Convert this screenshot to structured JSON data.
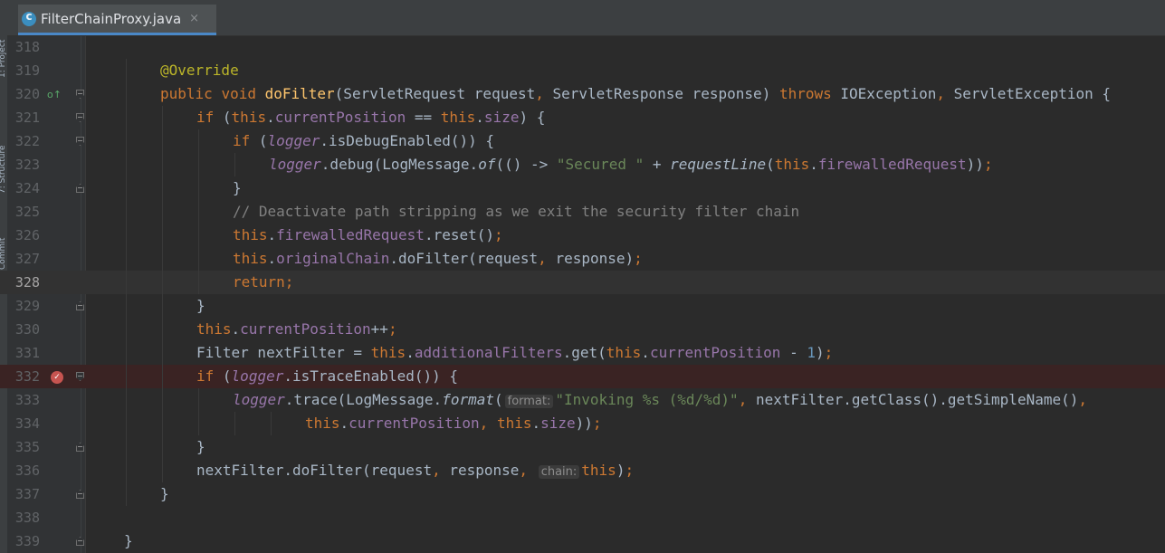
{
  "tab": {
    "title": "FilterChainProxy.java",
    "close_glyph": "×",
    "icon": "class-icon",
    "accent": "#4a88c7"
  },
  "side_panels": [
    "1: Project",
    "7: Structure",
    "Commit"
  ],
  "colors": {
    "background": "#2b2b2b",
    "keyword": "#cc7832",
    "field": "#9876aa",
    "method_decl": "#ffc66d",
    "string": "#6a8759",
    "number": "#6897bb",
    "comment": "#808080",
    "annotation": "#bbb529",
    "breakpoint": "#c75450"
  },
  "lines": [
    {
      "n": "318",
      "indent": 0,
      "tokens": []
    },
    {
      "n": "319",
      "indent": 2,
      "tokens": [
        [
          "ann",
          "@Override"
        ]
      ]
    },
    {
      "n": "320",
      "indent": 2,
      "gutter": "override-icon",
      "fold": "down",
      "tokens": [
        [
          "kw",
          "public "
        ],
        [
          "kw",
          "void "
        ],
        [
          "fn",
          "doFilter"
        ],
        [
          "pln",
          "(ServletRequest request"
        ],
        [
          "kw",
          ", "
        ],
        [
          "pln",
          "ServletResponse response) "
        ],
        [
          "kw",
          "throws "
        ],
        [
          "pln",
          "IOException"
        ],
        [
          "kw",
          ", "
        ],
        [
          "pln",
          "ServletException {"
        ]
      ]
    },
    {
      "n": "321",
      "indent": 3,
      "fold": "down",
      "tokens": [
        [
          "kw",
          "if "
        ],
        [
          "pln",
          "("
        ],
        [
          "kw",
          "this"
        ],
        [
          "pln",
          "."
        ],
        [
          "fld",
          "currentPosition"
        ],
        [
          "pln",
          " == "
        ],
        [
          "kw",
          "this"
        ],
        [
          "pln",
          "."
        ],
        [
          "fld",
          "size"
        ],
        [
          "pln",
          ") {"
        ]
      ]
    },
    {
      "n": "322",
      "indent": 4,
      "fold": "down",
      "tokens": [
        [
          "kw",
          "if "
        ],
        [
          "pln",
          "("
        ],
        [
          "sfld",
          "logger"
        ],
        [
          "pln",
          ".isDebugEnabled()) {"
        ]
      ]
    },
    {
      "n": "323",
      "indent": 5,
      "tokens": [
        [
          "sfld",
          "logger"
        ],
        [
          "pln",
          ".debug(LogMessage."
        ],
        [
          "sm",
          "of"
        ],
        [
          "pln",
          "(() -> "
        ],
        [
          "str",
          "\"Secured \""
        ],
        [
          "pln",
          " + "
        ],
        [
          "sm",
          "requestLine"
        ],
        [
          "pln",
          "("
        ],
        [
          "kw",
          "this"
        ],
        [
          "pln",
          "."
        ],
        [
          "fld",
          "firewalledRequest"
        ],
        [
          "pln",
          "))"
        ],
        [
          "kw",
          ";"
        ]
      ]
    },
    {
      "n": "324",
      "indent": 4,
      "fold": "up",
      "tokens": [
        [
          "pln",
          "}"
        ]
      ]
    },
    {
      "n": "325",
      "indent": 4,
      "tokens": [
        [
          "cmt",
          "// Deactivate path stripping as we exit the security filter chain"
        ]
      ]
    },
    {
      "n": "326",
      "indent": 4,
      "tokens": [
        [
          "kw",
          "this"
        ],
        [
          "pln",
          "."
        ],
        [
          "fld",
          "firewalledRequest"
        ],
        [
          "pln",
          ".reset()"
        ],
        [
          "kw",
          ";"
        ]
      ]
    },
    {
      "n": "327",
      "indent": 4,
      "tokens": [
        [
          "kw",
          "this"
        ],
        [
          "pln",
          "."
        ],
        [
          "fld",
          "originalChain"
        ],
        [
          "pln",
          ".doFilter(request"
        ],
        [
          "kw",
          ", "
        ],
        [
          "pln",
          "response)"
        ],
        [
          "kw",
          ";"
        ]
      ]
    },
    {
      "n": "328",
      "indent": 4,
      "current": true,
      "tokens": [
        [
          "kw",
          "return;"
        ]
      ]
    },
    {
      "n": "329",
      "indent": 3,
      "fold": "up",
      "tokens": [
        [
          "pln",
          "}"
        ]
      ]
    },
    {
      "n": "330",
      "indent": 3,
      "tokens": [
        [
          "kw",
          "this"
        ],
        [
          "pln",
          "."
        ],
        [
          "fld",
          "currentPosition"
        ],
        [
          "pln",
          "++"
        ],
        [
          "kw",
          ";"
        ]
      ]
    },
    {
      "n": "331",
      "indent": 3,
      "tokens": [
        [
          "pln",
          "Filter nextFilter = "
        ],
        [
          "kw",
          "this"
        ],
        [
          "pln",
          "."
        ],
        [
          "fld",
          "additionalFilters"
        ],
        [
          "pln",
          ".get("
        ],
        [
          "kw",
          "this"
        ],
        [
          "pln",
          "."
        ],
        [
          "fld",
          "currentPosition"
        ],
        [
          "pln",
          " - "
        ],
        [
          "num",
          "1"
        ],
        [
          "pln",
          ")"
        ],
        [
          "kw",
          ";"
        ]
      ]
    },
    {
      "n": "332",
      "indent": 3,
      "breakpoint": true,
      "gutter": "breakpoint-icon",
      "fold": "down",
      "tokens": [
        [
          "kw",
          "if "
        ],
        [
          "pln",
          "("
        ],
        [
          "sfld",
          "logger"
        ],
        [
          "pln",
          ".isTraceEnabled()) {"
        ]
      ]
    },
    {
      "n": "333",
      "indent": 4,
      "tokens": [
        [
          "sfld",
          "logger"
        ],
        [
          "pln",
          ".trace(LogMessage."
        ],
        [
          "sm",
          "format"
        ],
        [
          "pln",
          "("
        ],
        [
          "hint",
          "format:"
        ],
        [
          "str",
          "\"Invoking %s (%d/%d)\""
        ],
        [
          "kw",
          ", "
        ],
        [
          "pln",
          "nextFilter.getClass().getSimpleName()"
        ],
        [
          "kw",
          ","
        ]
      ]
    },
    {
      "n": "334",
      "indent": 6,
      "tokens": [
        [
          "kw",
          "this"
        ],
        [
          "pln",
          "."
        ],
        [
          "fld",
          "currentPosition"
        ],
        [
          "kw",
          ", "
        ],
        [
          "kw",
          "this"
        ],
        [
          "pln",
          "."
        ],
        [
          "fld",
          "size"
        ],
        [
          "pln",
          "))"
        ],
        [
          "kw",
          ";"
        ]
      ]
    },
    {
      "n": "335",
      "indent": 3,
      "fold": "up",
      "tokens": [
        [
          "pln",
          "}"
        ]
      ]
    },
    {
      "n": "336",
      "indent": 3,
      "tokens": [
        [
          "pln",
          "nextFilter.doFilter(request"
        ],
        [
          "kw",
          ", "
        ],
        [
          "pln",
          "response"
        ],
        [
          "kw",
          ", "
        ],
        [
          "hint",
          "chain:"
        ],
        [
          "kw",
          "this"
        ],
        [
          "pln",
          ")"
        ],
        [
          "kw",
          ";"
        ]
      ]
    },
    {
      "n": "337",
      "indent": 2,
      "fold": "up",
      "tokens": [
        [
          "pln",
          "}"
        ]
      ]
    },
    {
      "n": "338",
      "indent": 0,
      "tokens": []
    },
    {
      "n": "339",
      "indent": 1,
      "fold": "up",
      "tokens": [
        [
          "pln",
          "}"
        ]
      ]
    }
  ]
}
